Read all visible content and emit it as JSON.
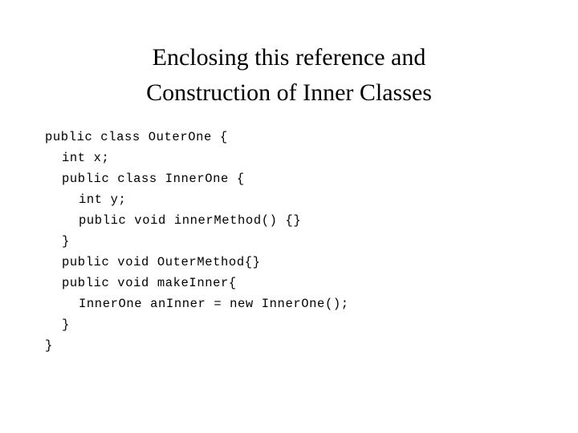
{
  "slide": {
    "background_color": "#ffffff",
    "text_color": "#000000",
    "title": {
      "lines": [
        "Enclosing this reference and",
        "Construction of Inner Classes"
      ]
    },
    "code": {
      "language": "java",
      "lines": [
        {
          "text": "public class OuterOne {",
          "indent": 0
        },
        {
          "text": "int x;",
          "indent": 1
        },
        {
          "text": "public class InnerOne {",
          "indent": 1
        },
        {
          "text": "int y;",
          "indent": 2
        },
        {
          "text": "public void innerMethod() {}",
          "indent": 2
        },
        {
          "text": "}",
          "indent": 1
        },
        {
          "text": "public void OuterMethod{}",
          "indent": 1
        },
        {
          "text": "public void makeInner{",
          "indent": 1
        },
        {
          "text": "InnerOne anInner = new InnerOne();",
          "indent": 2
        },
        {
          "text": "}",
          "indent": 1
        },
        {
          "text": "}",
          "indent": 0
        }
      ]
    }
  }
}
